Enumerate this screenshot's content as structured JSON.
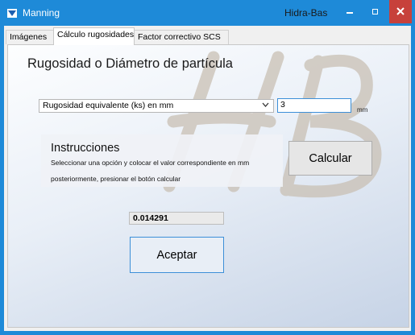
{
  "window": {
    "title": "Manning",
    "app_name": "Hidra-Bas",
    "accent_color": "#1e8ad8",
    "close_color": "#c7413b",
    "icons": [
      "app-icon",
      "minimize-icon",
      "maximize-icon",
      "close-icon"
    ]
  },
  "tabs": [
    {
      "label": "Imágenes",
      "active": false
    },
    {
      "label": "Cálculo rugosidades",
      "active": true
    },
    {
      "label": "Factor correctivo SCS",
      "active": false
    }
  ],
  "form": {
    "heading": "Rugosidad o Diámetro de partícula",
    "select_value": "Rugosidad equivalente (ks) en mm",
    "value_input": "3",
    "unit": "mm"
  },
  "instructions": {
    "title": "Instrucciones",
    "line1": "Seleccionar una opción y colocar el valor correspondiente en mm",
    "line2": "posteriormente, presionar el botón calcular"
  },
  "buttons": {
    "calculate": "Calcular",
    "accept": "Aceptar"
  },
  "result": {
    "value": "0.014291"
  }
}
